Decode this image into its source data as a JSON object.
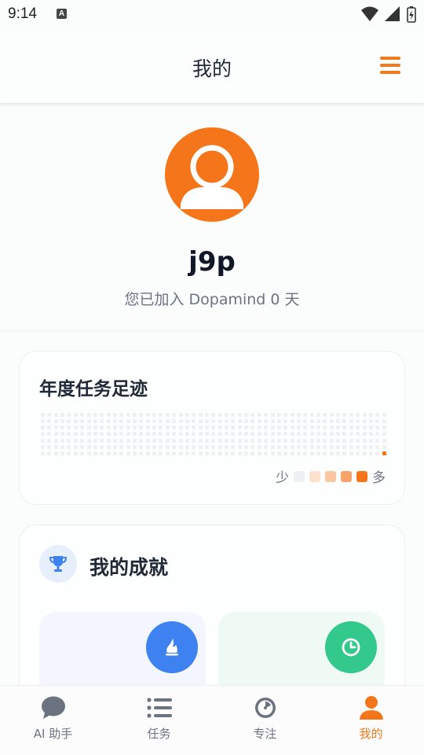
{
  "status_bar": {
    "time": "9:14",
    "badge": "A"
  },
  "header": {
    "title": "我的"
  },
  "profile": {
    "username": "j9p",
    "joined_text": "您已加入 Dopamind 0 天"
  },
  "footprint": {
    "title": "年度任务足迹",
    "legend_less": "少",
    "legend_more": "多",
    "legend_colors": [
      "#eef0f3",
      "#fde1cf",
      "#fbc6a1",
      "#f8a36b",
      "#f5761a"
    ]
  },
  "achievements": {
    "title": "我的成就"
  },
  "nav": {
    "items": [
      {
        "label": "AI 助手",
        "icon": "chat-icon"
      },
      {
        "label": "任务",
        "icon": "list-icon"
      },
      {
        "label": "专注",
        "icon": "timer-icon"
      },
      {
        "label": "我的",
        "icon": "person-icon",
        "active": true
      }
    ]
  },
  "colors": {
    "accent": "#f5761a",
    "blue": "#3d82f0",
    "green": "#33c88c"
  }
}
